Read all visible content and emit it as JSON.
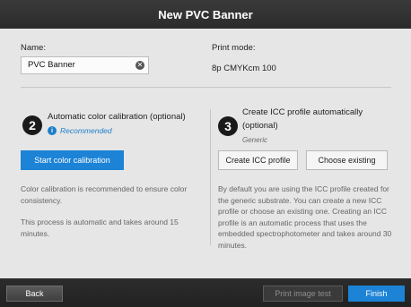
{
  "window": {
    "title": "New PVC Banner"
  },
  "name_section": {
    "label": "Name:",
    "value": "PVC Banner",
    "clear_icon": "clear-icon"
  },
  "print_mode": {
    "label": "Print mode:",
    "value": "8p CMYKcm 100"
  },
  "calibration": {
    "step": "2",
    "title": "Automatic color calibration (optional)",
    "recommended": "Recommended",
    "info_icon": "info-icon",
    "button": "Start color calibration",
    "desc1": "Color calibration is recommended to ensure color consistency.",
    "desc2": "This process is automatic and takes around 15 minutes."
  },
  "icc": {
    "step": "3",
    "title_line1": "Create ICC profile automatically",
    "title_line2": "(optional)",
    "subtitle": "Generic",
    "create_button": "Create ICC profile",
    "choose_button": "Choose existing",
    "desc": "By default you are using the ICC profile created for the generic substrate. You can create a new ICC profile or choose an existing one. Creating an ICC profile is an automatic process that uses the embedded spectrophotometer and takes around 30 minutes."
  },
  "footer": {
    "back": "Back",
    "print_test": "Print image test",
    "finish": "Finish"
  },
  "colors": {
    "accent": "#1c83d6",
    "title_bar": "#2e2e2e",
    "panel": "#e6e6e6"
  }
}
